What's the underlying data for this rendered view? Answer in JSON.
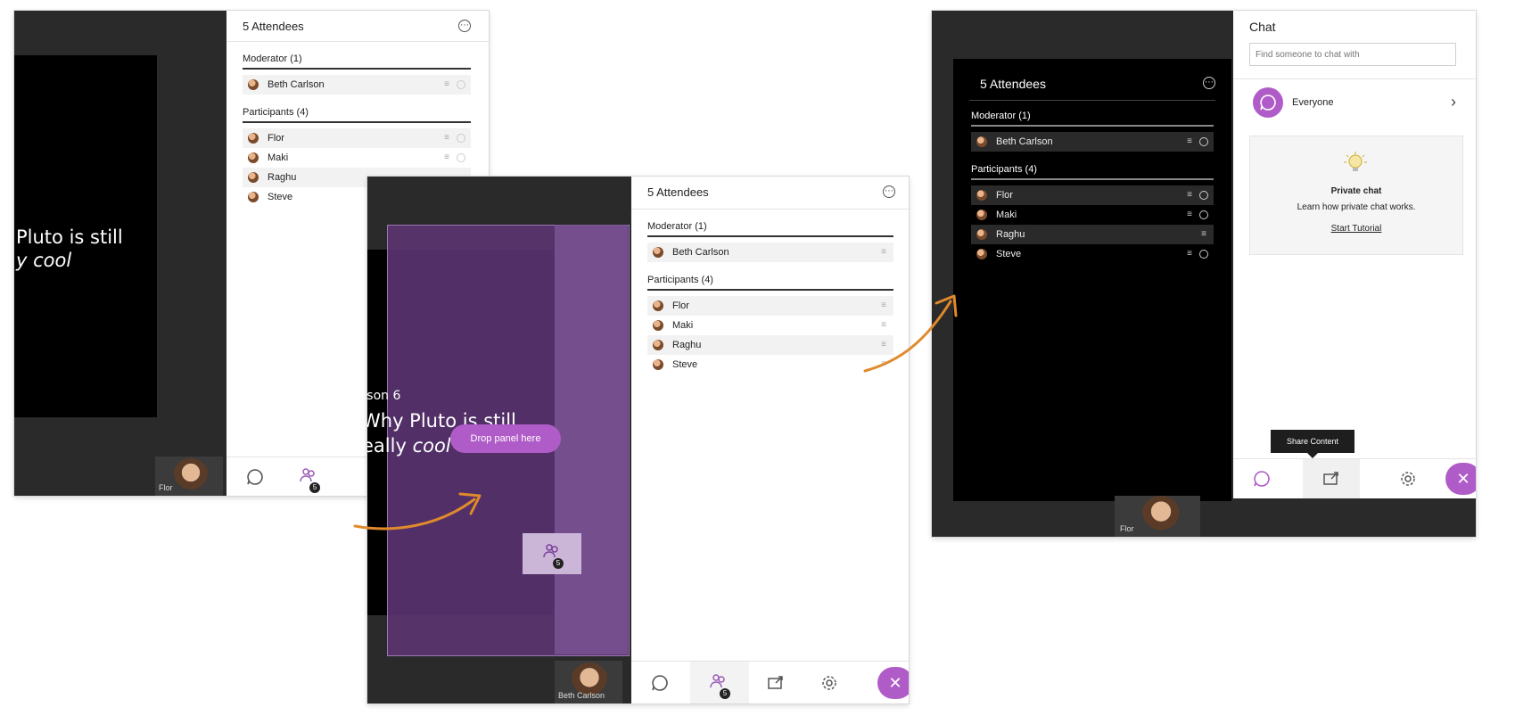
{
  "colors": {
    "accent": "#b05cc8",
    "arrow": "#e08a2c",
    "drop_overlay": "#6a3f82"
  },
  "icons": [
    "chat-icon",
    "attendees-icon",
    "share-content-icon",
    "settings-icon",
    "close-icon",
    "more-options-icon",
    "lightbulb-icon",
    "chevron-right-icon",
    "drag-handle-icon",
    "curved-arrow-icon"
  ],
  "screen1": {
    "panel_title": "5 Attendees",
    "moderator_header": "Moderator (1)",
    "moderators": [
      "Beth Carlson"
    ],
    "participants_header": "Participants (4)",
    "participants": [
      "Flor",
      "Maki",
      "Raghu",
      "Steve"
    ],
    "slide_line1": "Pluto is still",
    "slide_line2": "y cool",
    "camera_name": "Flor",
    "badge_count": "5"
  },
  "screen2": {
    "panel_title": "5 Attendees",
    "moderator_header": "Moderator (1)",
    "moderators": [
      "Beth Carlson"
    ],
    "participants_header": "Participants (4)",
    "participants": [
      "Flor",
      "Maki",
      "Raghu",
      "Steve"
    ],
    "slide_lesson": "sson 6",
    "slide_line1": "Why Pluto is still",
    "slide_line2_prefix": "eally ",
    "slide_line2_italic": "cool",
    "drop_label": "Drop panel here",
    "camera_name": "Beth Carlson",
    "badge_count": "5"
  },
  "screen3": {
    "attendees_title": "5 Attendees",
    "moderator_header": "Moderator (1)",
    "moderators": [
      "Beth Carlson"
    ],
    "participants_header": "Participants (4)",
    "participants": [
      "Flor",
      "Maki",
      "Raghu",
      "Steve"
    ],
    "chat_title": "Chat",
    "chat_search_placeholder": "Find someone to chat with",
    "everyone_label": "Everyone",
    "private_chat_title": "Private chat",
    "private_chat_desc": "Learn how private chat works.",
    "start_tutorial": "Start Tutorial",
    "tooltip": "Share Content",
    "camera_name": "Flor"
  }
}
